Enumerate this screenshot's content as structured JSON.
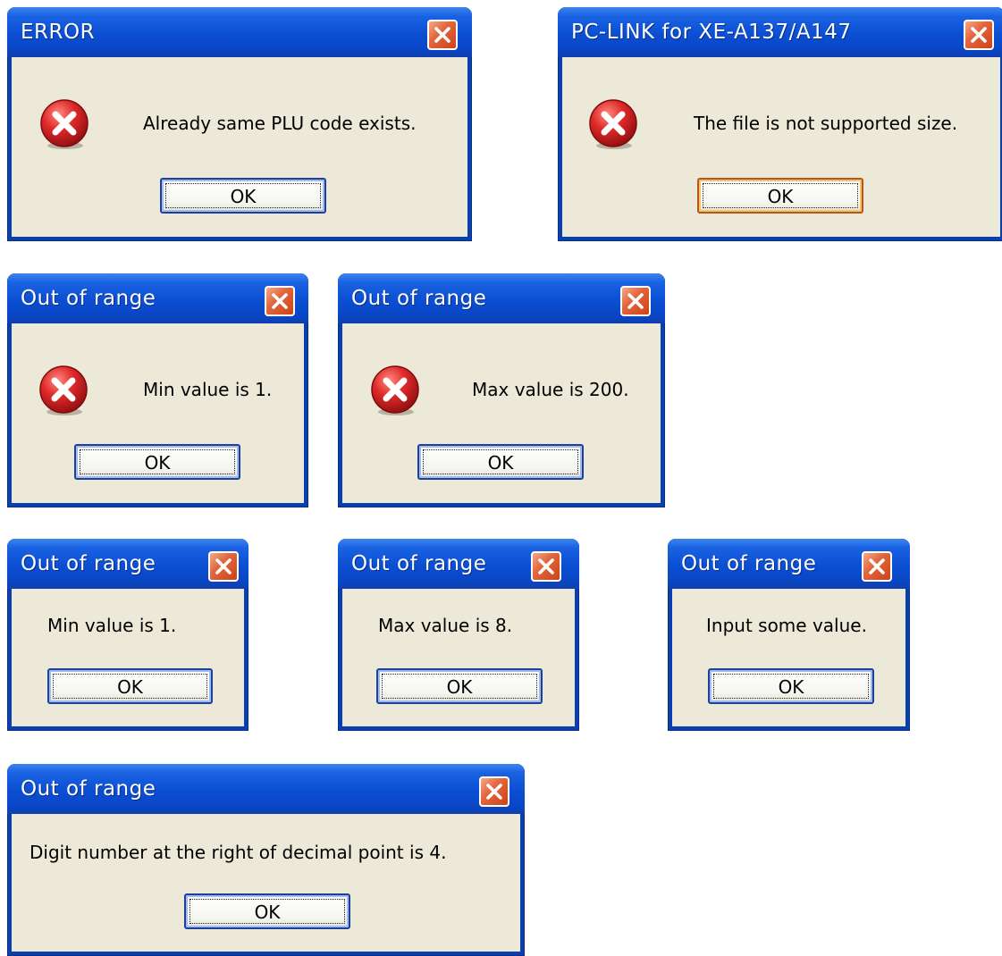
{
  "dialogs": [
    {
      "title": "ERROR",
      "message": "Already same PLU code exists.",
      "button": "OK",
      "has_error_icon": true
    },
    {
      "title": "PC-LINK for XE-A137/A147",
      "message": "The file is not supported size.",
      "button": "OK",
      "has_error_icon": true
    },
    {
      "title": "Out of range",
      "message": "Min value is 1.",
      "button": "OK",
      "has_error_icon": true
    },
    {
      "title": "Out of range",
      "message": "Max value is 200.",
      "button": "OK",
      "has_error_icon": true
    },
    {
      "title": "Out of range",
      "message": "Min value is 1.",
      "button": "OK",
      "has_error_icon": false
    },
    {
      "title": "Out of range",
      "message": "Max value is 8.",
      "button": "OK",
      "has_error_icon": false
    },
    {
      "title": "Out of range",
      "message": "Input some value.",
      "button": "OK",
      "has_error_icon": false
    },
    {
      "title": "Out of range",
      "message": "Digit number at the right of decimal point is 4.",
      "button": "OK",
      "has_error_icon": false
    }
  ],
  "icons": {
    "close": "close-icon",
    "error": "error-icon"
  },
  "colors": {
    "titlebar": "#0b4ed3",
    "frame": "#0a3fb0",
    "dialog_body": "#ece9d8",
    "close_button": "#e2673e",
    "error_icon": "#d4272f"
  }
}
